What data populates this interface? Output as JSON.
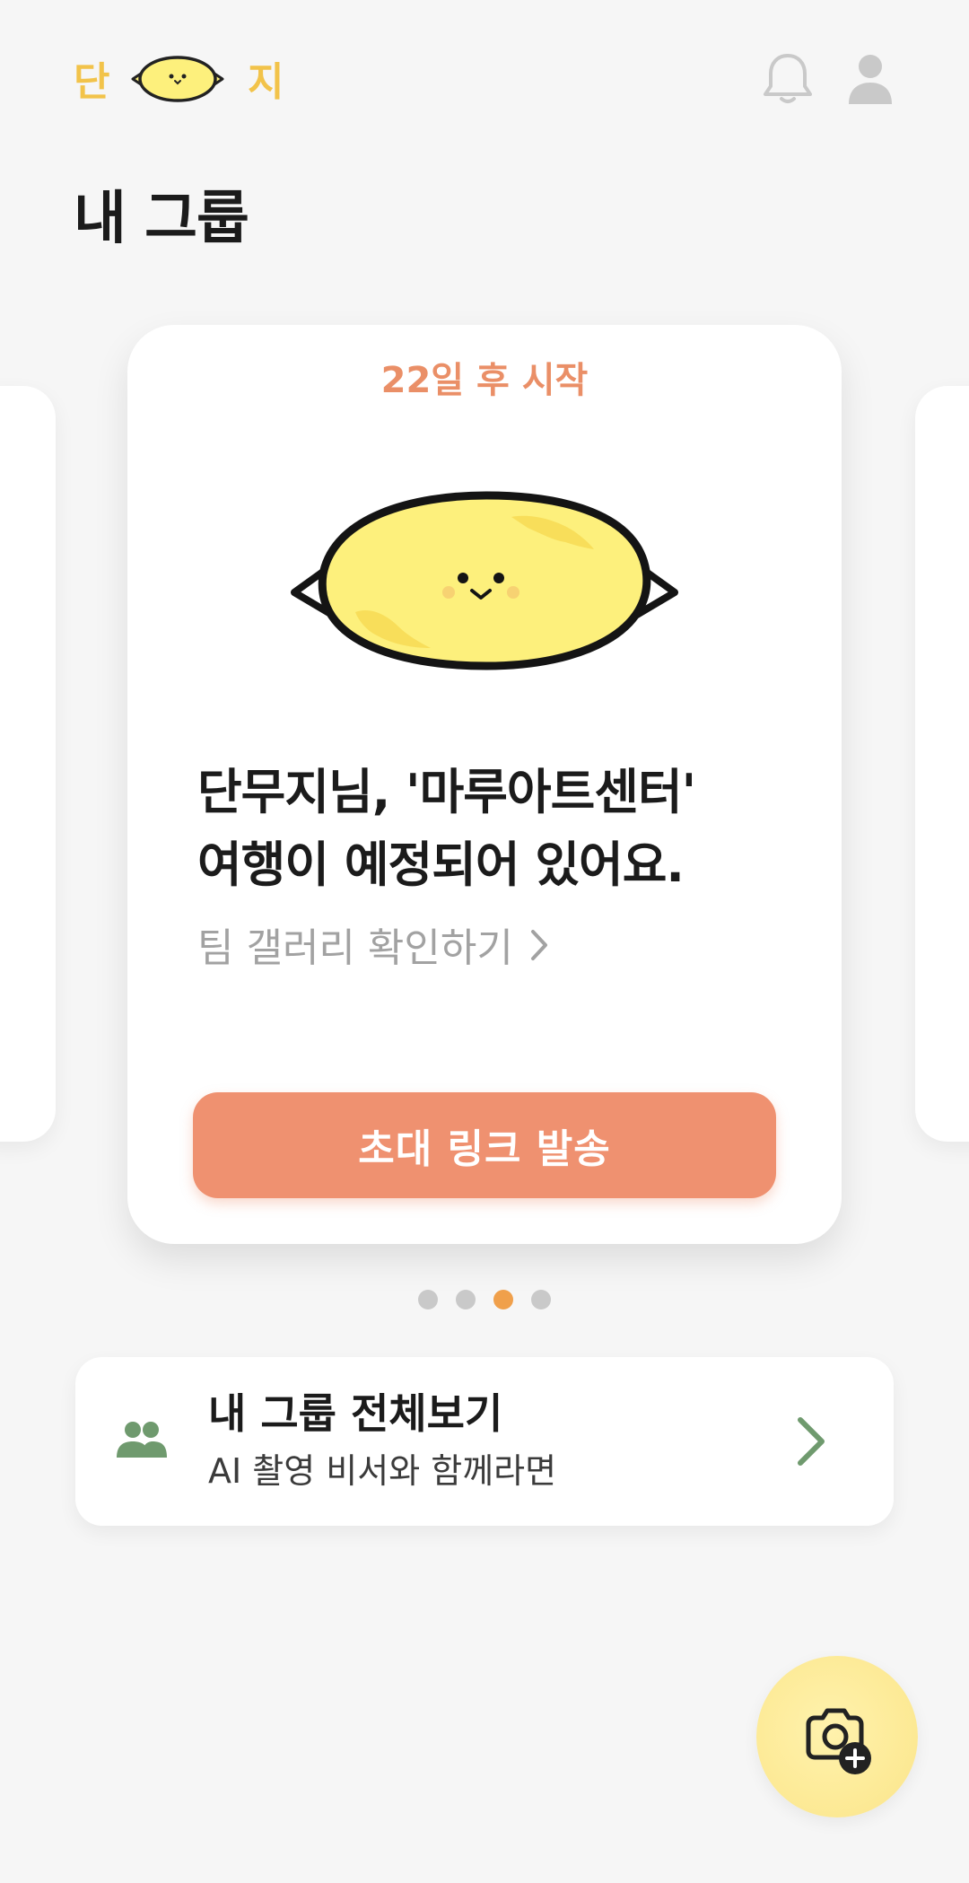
{
  "header": {
    "logo_left": "단",
    "logo_right": "지",
    "logo_icon": "pickled-radish-mascot-icon",
    "bell_icon": "bell-icon",
    "profile_icon": "user-icon"
  },
  "page_title": "내 그룹",
  "carousel": {
    "card": {
      "badge": "22일 후 시작",
      "mascot_icon": "pickled-radish-mascot-icon",
      "headline_line1": "단무지님, '마루아트센터'",
      "headline_line2": "여행이 예정되어 있어요.",
      "gallery_link": "팀 갤러리 확인하기",
      "invite_button": "초대 링크 발송"
    },
    "pagination": {
      "total": 4,
      "active_index": 2
    }
  },
  "groups_card": {
    "icon": "group-icon",
    "title": "내 그룹 전체보기",
    "subtitle": "AI 촬영 비서와 함께라면"
  },
  "fab": {
    "icon": "camera-add-icon"
  },
  "colors": {
    "accent": "#ef9170",
    "badge": "#ea8f67",
    "logo": "#f2c34a",
    "mascot": "#fdf07c",
    "green": "#6f9a6e",
    "dot_active": "#f0a04b",
    "fab": "#fdeb99"
  }
}
